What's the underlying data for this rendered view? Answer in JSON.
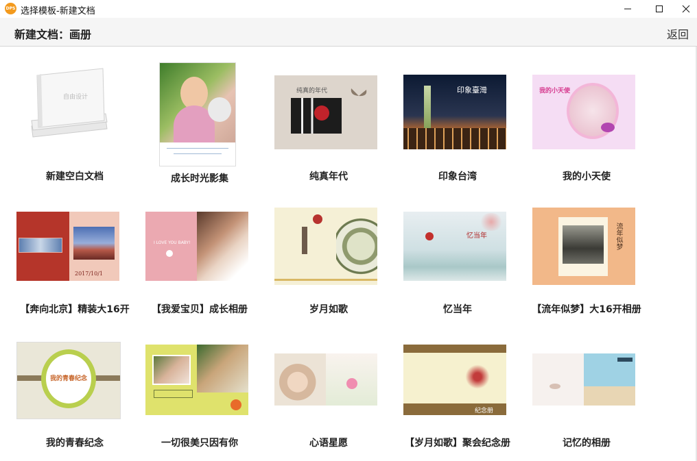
{
  "window": {
    "app_icon_text": "DPS",
    "title": "选择模板-新建文档"
  },
  "header": {
    "title": "新建文档：画册",
    "back_label": "返回"
  },
  "templates": [
    {
      "label": "新建空白文档",
      "thumb_text": "自由设计"
    },
    {
      "label": "成长时光影集"
    },
    {
      "label": "纯真年代",
      "thumb_text": "纯真的年代"
    },
    {
      "label": "印象台湾",
      "thumb_text": "印象臺灣"
    },
    {
      "label": "我的小天使",
      "thumb_text": "我的小天使"
    },
    {
      "label": "【奔向北京】精装大16开",
      "thumb_text": "2017/10/1"
    },
    {
      "label": "【我爱宝贝】成长相册",
      "thumb_text": "I LOVE YOU BABY!"
    },
    {
      "label": "岁月如歌"
    },
    {
      "label": "忆当年",
      "thumb_text": "忆当年"
    },
    {
      "label": "【流年似梦】大16开相册",
      "thumb_text": "流年似梦"
    },
    {
      "label": "我的青春纪念",
      "thumb_text": "我的青春纪念"
    },
    {
      "label": "一切很美只因有你"
    },
    {
      "label": "心语星愿"
    },
    {
      "label": "【岁月如歌】聚会纪念册",
      "thumb_text": "纪念册"
    },
    {
      "label": "记忆的相册"
    }
  ]
}
